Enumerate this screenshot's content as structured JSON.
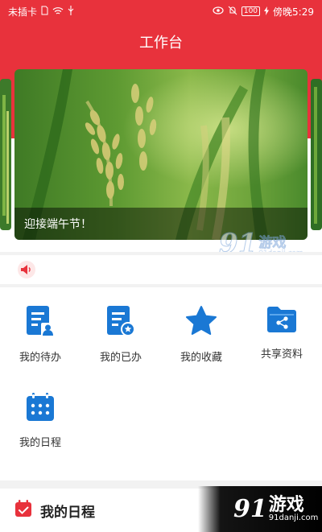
{
  "status_bar": {
    "carrier": "未插卡",
    "battery": "100",
    "time": "傍晚5:29",
    "icons": [
      "sim-icon",
      "wifi-icon",
      "usb-icon",
      "eye-icon",
      "mute-icon",
      "battery-icon",
      "charging-icon"
    ]
  },
  "header": {
    "title": "工作台"
  },
  "banner": {
    "caption": "迎接端午节！",
    "image": "rice-field-photo"
  },
  "watermark": {
    "number": "91",
    "name": "游戏",
    "url": "91danji.com"
  },
  "notice": {
    "icon": "speaker-icon"
  },
  "grid": {
    "items": [
      {
        "label": "我的待办",
        "icon": "todo-icon"
      },
      {
        "label": "我的已办",
        "icon": "done-icon"
      },
      {
        "label": "我的收藏",
        "icon": "star-icon"
      },
      {
        "label": "共享资料",
        "icon": "share-folder-icon"
      },
      {
        "label": "我的日程",
        "icon": "calendar-icon"
      }
    ]
  },
  "schedule": {
    "title": "我的日程",
    "icon": "calendar-check-icon"
  },
  "colors": {
    "brand_red": "#e8323c",
    "icon_blue": "#1a78d4"
  }
}
